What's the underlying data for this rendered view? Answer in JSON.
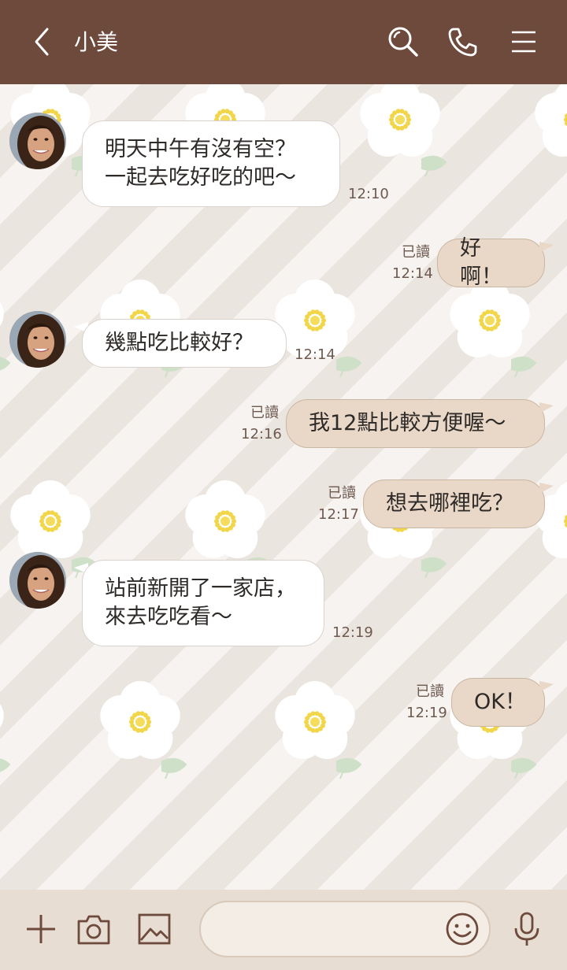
{
  "header": {
    "title": "小美",
    "icons": [
      "back-icon",
      "search-icon",
      "phone-icon",
      "menu-icon"
    ]
  },
  "messages": [
    {
      "side": "in",
      "text": "明天中午有沒有空？\n一起去吃好吃的吧～",
      "time": "12:10"
    },
    {
      "side": "out",
      "text": "好啊！",
      "time": "12:14",
      "read": "已讀"
    },
    {
      "side": "in",
      "text": "幾點吃比較好？",
      "time": "12:14"
    },
    {
      "side": "out",
      "text": "我12點比較方便喔～",
      "time": "12:16",
      "read": "已讀"
    },
    {
      "side": "out",
      "text": "想去哪裡吃？",
      "time": "12:17",
      "read": "已讀"
    },
    {
      "side": "in",
      "text": "站前新開了一家店，\n來去吃吃看～",
      "time": "12:19"
    },
    {
      "side": "out",
      "text": "OK！",
      "time": "12:19",
      "read": "已讀"
    }
  ],
  "composer": {
    "icons": [
      "plus-icon",
      "camera-icon",
      "image-icon",
      "emoji-icon",
      "microphone-icon"
    ],
    "value": ""
  },
  "colors": {
    "header_bg": "#6e4a3c",
    "incoming_bubble": "#ffffff",
    "outgoing_bubble": "#e9d8c7",
    "footer_bg": "#e7ddd2"
  }
}
